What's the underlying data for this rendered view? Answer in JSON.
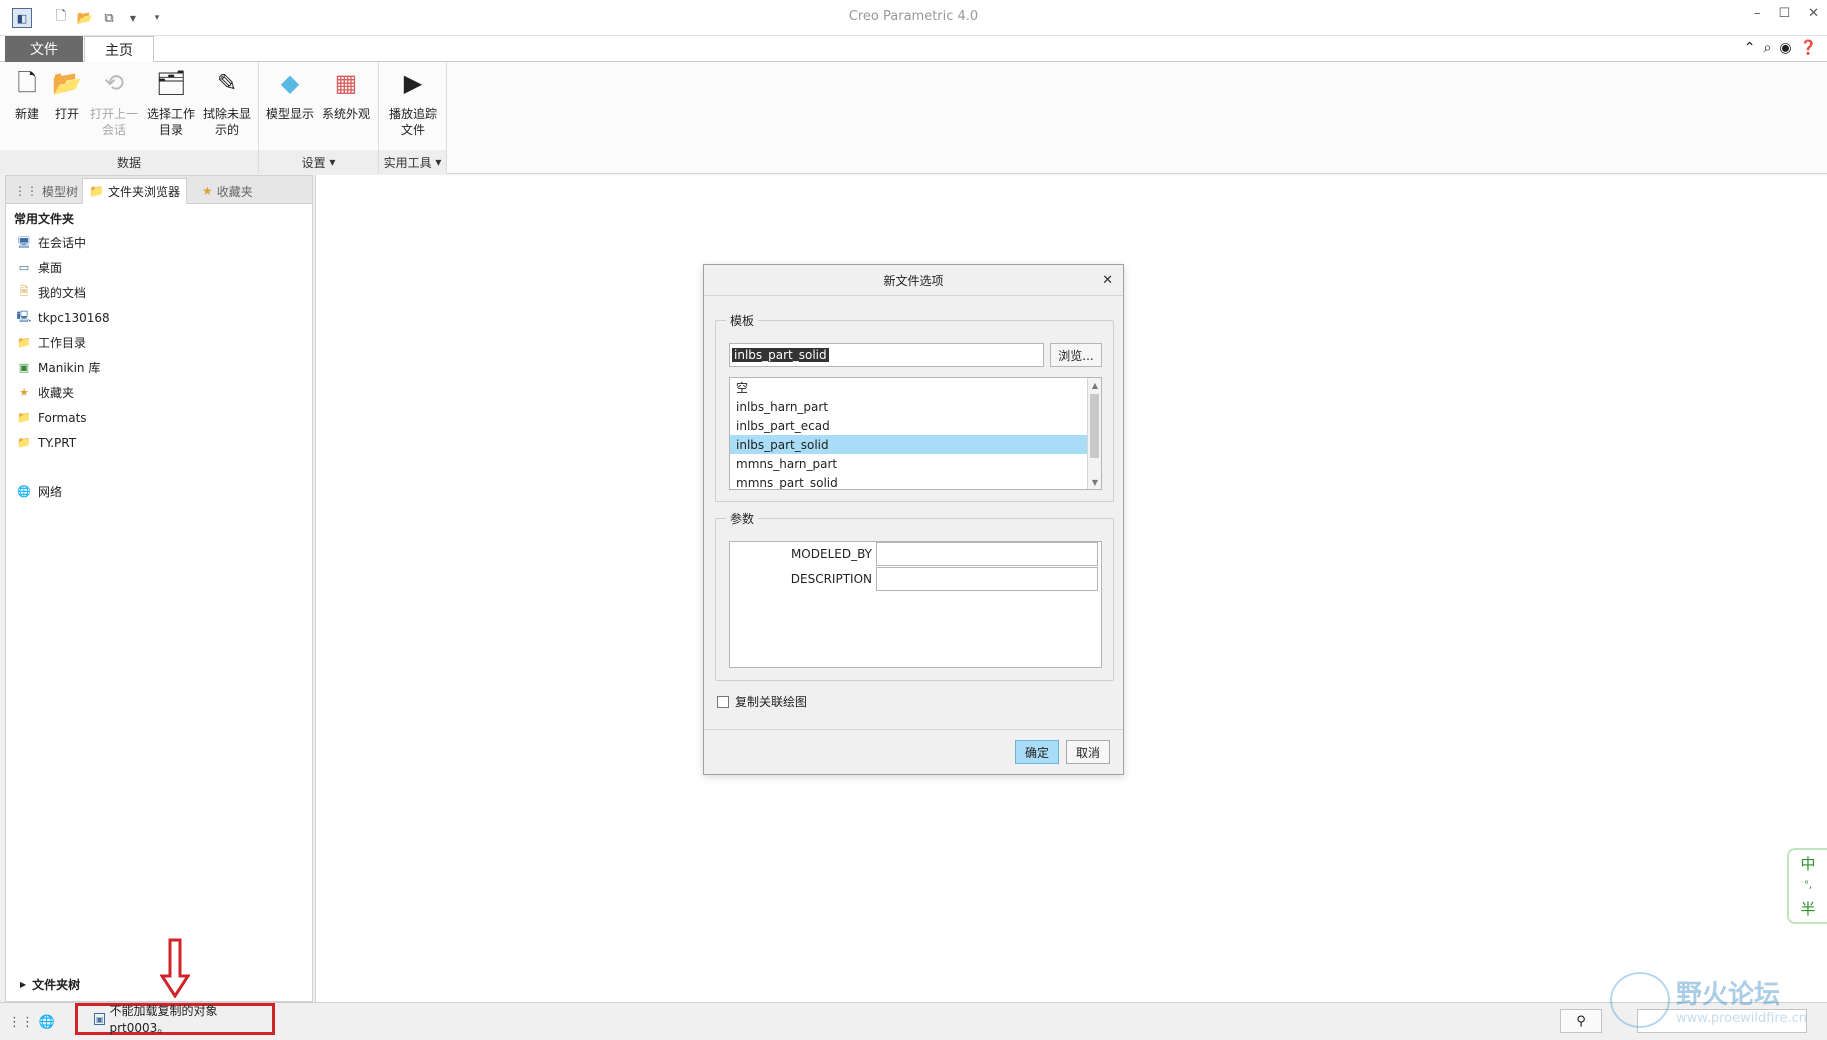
{
  "window": {
    "title": "Creo Parametric 4.0"
  },
  "ribbon_tabs": {
    "file": "文件",
    "home": "主页"
  },
  "ribbon": {
    "data_group": {
      "label": "数据",
      "buttons": [
        {
          "label": "新建",
          "icon": "new-file-icon"
        },
        {
          "label": "打开",
          "icon": "open-folder-icon"
        },
        {
          "label": "打开上一会话",
          "icon": "open-last-session-icon"
        },
        {
          "label": "选择工作目录",
          "icon": "select-workdir-icon"
        },
        {
          "label": "拭除未显示的",
          "icon": "erase-not-displayed-icon"
        }
      ]
    },
    "settings_group": {
      "label": "设置",
      "buttons": [
        {
          "label": "模型显示",
          "icon": "model-display-icon"
        },
        {
          "label": "系统外观",
          "icon": "system-appearance-icon"
        }
      ]
    },
    "utilities_group": {
      "label": "实用工具",
      "buttons": [
        {
          "label": "播放追踪文件",
          "icon": "play-trail-icon"
        }
      ]
    }
  },
  "left_panel": {
    "tabs": [
      "模型树",
      "文件夹浏览器",
      "收藏夹"
    ],
    "active_tab": "文件夹浏览器",
    "common_folders_header": "常用文件夹",
    "folders": [
      {
        "label": "在会话中",
        "icon": "in-session-icon"
      },
      {
        "label": "桌面",
        "icon": "desktop-icon"
      },
      {
        "label": "我的文档",
        "icon": "my-documents-icon"
      },
      {
        "label": "tkpc130168",
        "icon": "computer-icon"
      },
      {
        "label": "工作目录",
        "icon": "working-dir-icon"
      },
      {
        "label": "Manikin 库",
        "icon": "manikin-library-icon"
      },
      {
        "label": "收藏夹",
        "icon": "favorites-icon"
      },
      {
        "label": "Formats",
        "icon": "folder-icon"
      },
      {
        "label": "TY.PRT",
        "icon": "folder-icon"
      }
    ],
    "network": {
      "label": "网络",
      "icon": "network-icon"
    },
    "folder_tree_label": "文件夹树"
  },
  "dialog": {
    "title": "新文件选项",
    "template_legend": "模板",
    "template_value": "inlbs_part_solid",
    "browse_label": "浏览...",
    "template_list": [
      "空",
      "inlbs_harn_part",
      "inlbs_part_ecad",
      "inlbs_part_solid",
      "mmns_harn_part",
      "mmns_part_solid"
    ],
    "selected_template": "inlbs_part_solid",
    "params_legend": "参数",
    "params": [
      {
        "name": "MODELED_BY",
        "value": ""
      },
      {
        "name": "DESCRIPTION",
        "value": ""
      }
    ],
    "copy_drawing_label": "复制关联绘图",
    "copy_drawing_checked": false,
    "ok_label": "确定",
    "cancel_label": "取消"
  },
  "status_bar": {
    "message": "不能加载复制的对象 prt0003。"
  },
  "ime": {
    "line1": "中",
    "line2": "°,",
    "line3": "半"
  },
  "watermark": {
    "text": "野火论坛",
    "url": "www.proewildfire.cn"
  },
  "colors": {
    "highlight": "#a9dcf7",
    "annotation_red": "#d2232a"
  }
}
